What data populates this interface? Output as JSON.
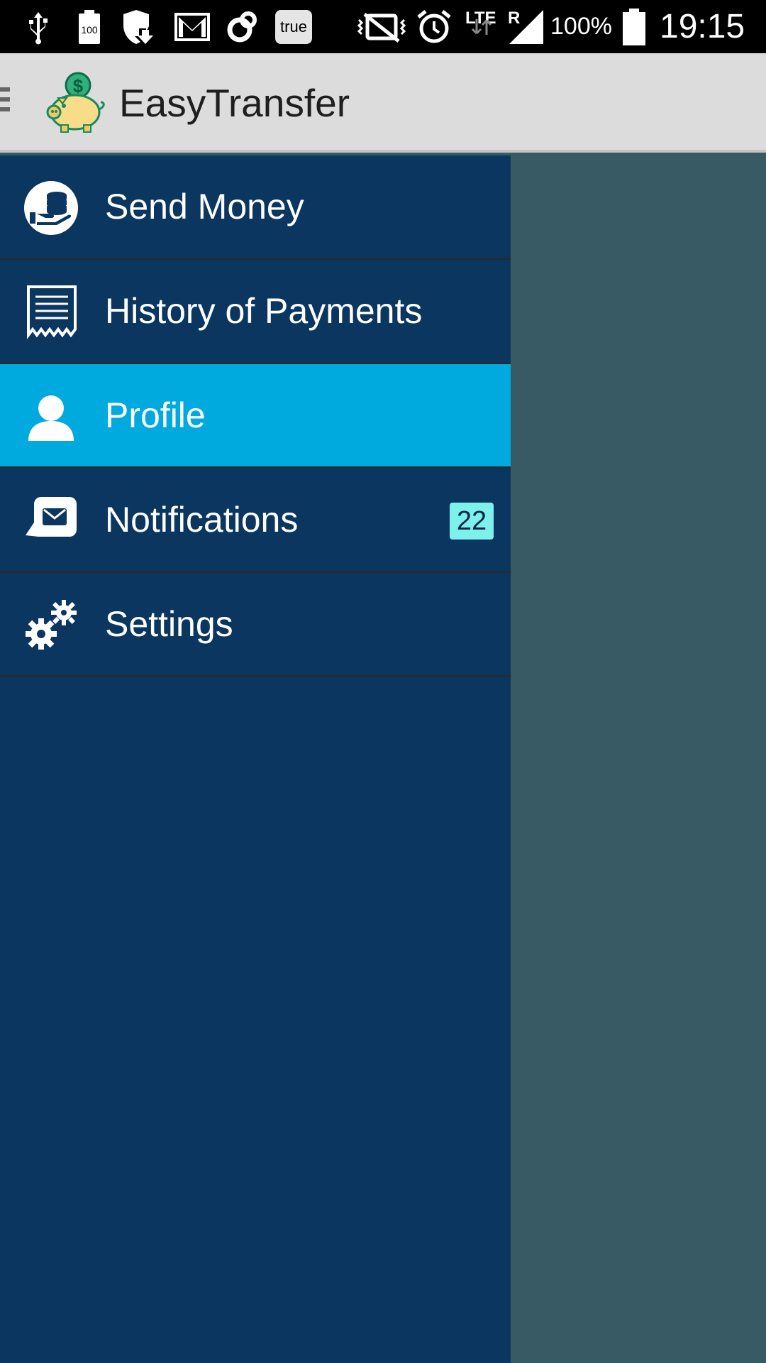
{
  "status_bar": {
    "icons": [
      "usb-icon",
      "battery-100-icon",
      "shield-update-icon",
      "gmail-icon",
      "sync-icon",
      "true-app-icon",
      "vibrate-icon",
      "alarm-icon",
      "lte-icon",
      "signal-icon",
      "battery-icon"
    ],
    "battery_badge": "100",
    "true_badge": "true",
    "network_type": "LTE",
    "roaming": "R",
    "battery_percent": "100%",
    "time": "19:15"
  },
  "action_bar": {
    "title": "EasyTransfer",
    "logo_icon": "piggy-bank-dollar-icon",
    "logo_symbol": "$"
  },
  "drawer": {
    "items": [
      {
        "label": "Send Money",
        "icon": "coins-hand-icon",
        "active": false
      },
      {
        "label": "History of Payments",
        "icon": "receipt-icon",
        "active": false
      },
      {
        "label": "Profile",
        "icon": "person-icon",
        "active": true
      },
      {
        "label": "Notifications",
        "icon": "envelope-chat-icon",
        "active": false,
        "badge": "22"
      },
      {
        "label": "Settings",
        "icon": "gears-icon",
        "active": false
      }
    ]
  },
  "colors": {
    "drawer_bg": "#0b3660",
    "active_item": "#00aade",
    "badge_bg": "#7df1ec",
    "action_bar": "#dcdcdc",
    "scrim": "#385a64"
  }
}
